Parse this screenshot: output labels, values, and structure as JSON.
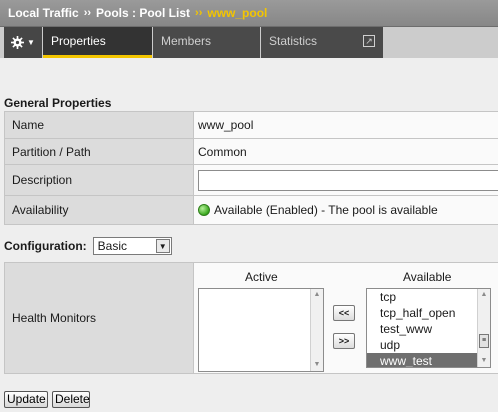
{
  "breadcrumb": {
    "root": "Local Traffic",
    "sep1": "››",
    "section": "Pools : Pool List",
    "sep2": "››",
    "current": "www_pool"
  },
  "tabs": [
    {
      "label": "Properties",
      "active": true
    },
    {
      "label": "Members",
      "active": false
    },
    {
      "label": "Statistics",
      "active": false
    }
  ],
  "icons": {
    "settings": "gear-icon",
    "menu_caret": "caret-down-icon",
    "external": "external-link-icon",
    "status": "green-circle-icon"
  },
  "colors": {
    "accent": "#f3c500",
    "available": "#39a81d"
  },
  "general": {
    "title": "General Properties",
    "rows": [
      {
        "label": "Name",
        "value": "www_pool"
      },
      {
        "label": "Partition / Path",
        "value": "Common"
      },
      {
        "label": "Description",
        "value": ""
      },
      {
        "label": "Availability",
        "value": "Available (Enabled) - The pool is available"
      }
    ]
  },
  "configuration": {
    "label": "Configuration:",
    "selected": "Basic"
  },
  "health_monitors": {
    "label": "Health Monitors",
    "active_header": "Active",
    "available_header": "Available",
    "active": [],
    "available": [
      "tcp",
      "tcp_half_open",
      "test_www",
      "udp",
      "www_test"
    ],
    "selected": "www_test",
    "add_label": "<<",
    "remove_label": ">>"
  },
  "actions": {
    "update": "Update",
    "delete": "Delete"
  }
}
